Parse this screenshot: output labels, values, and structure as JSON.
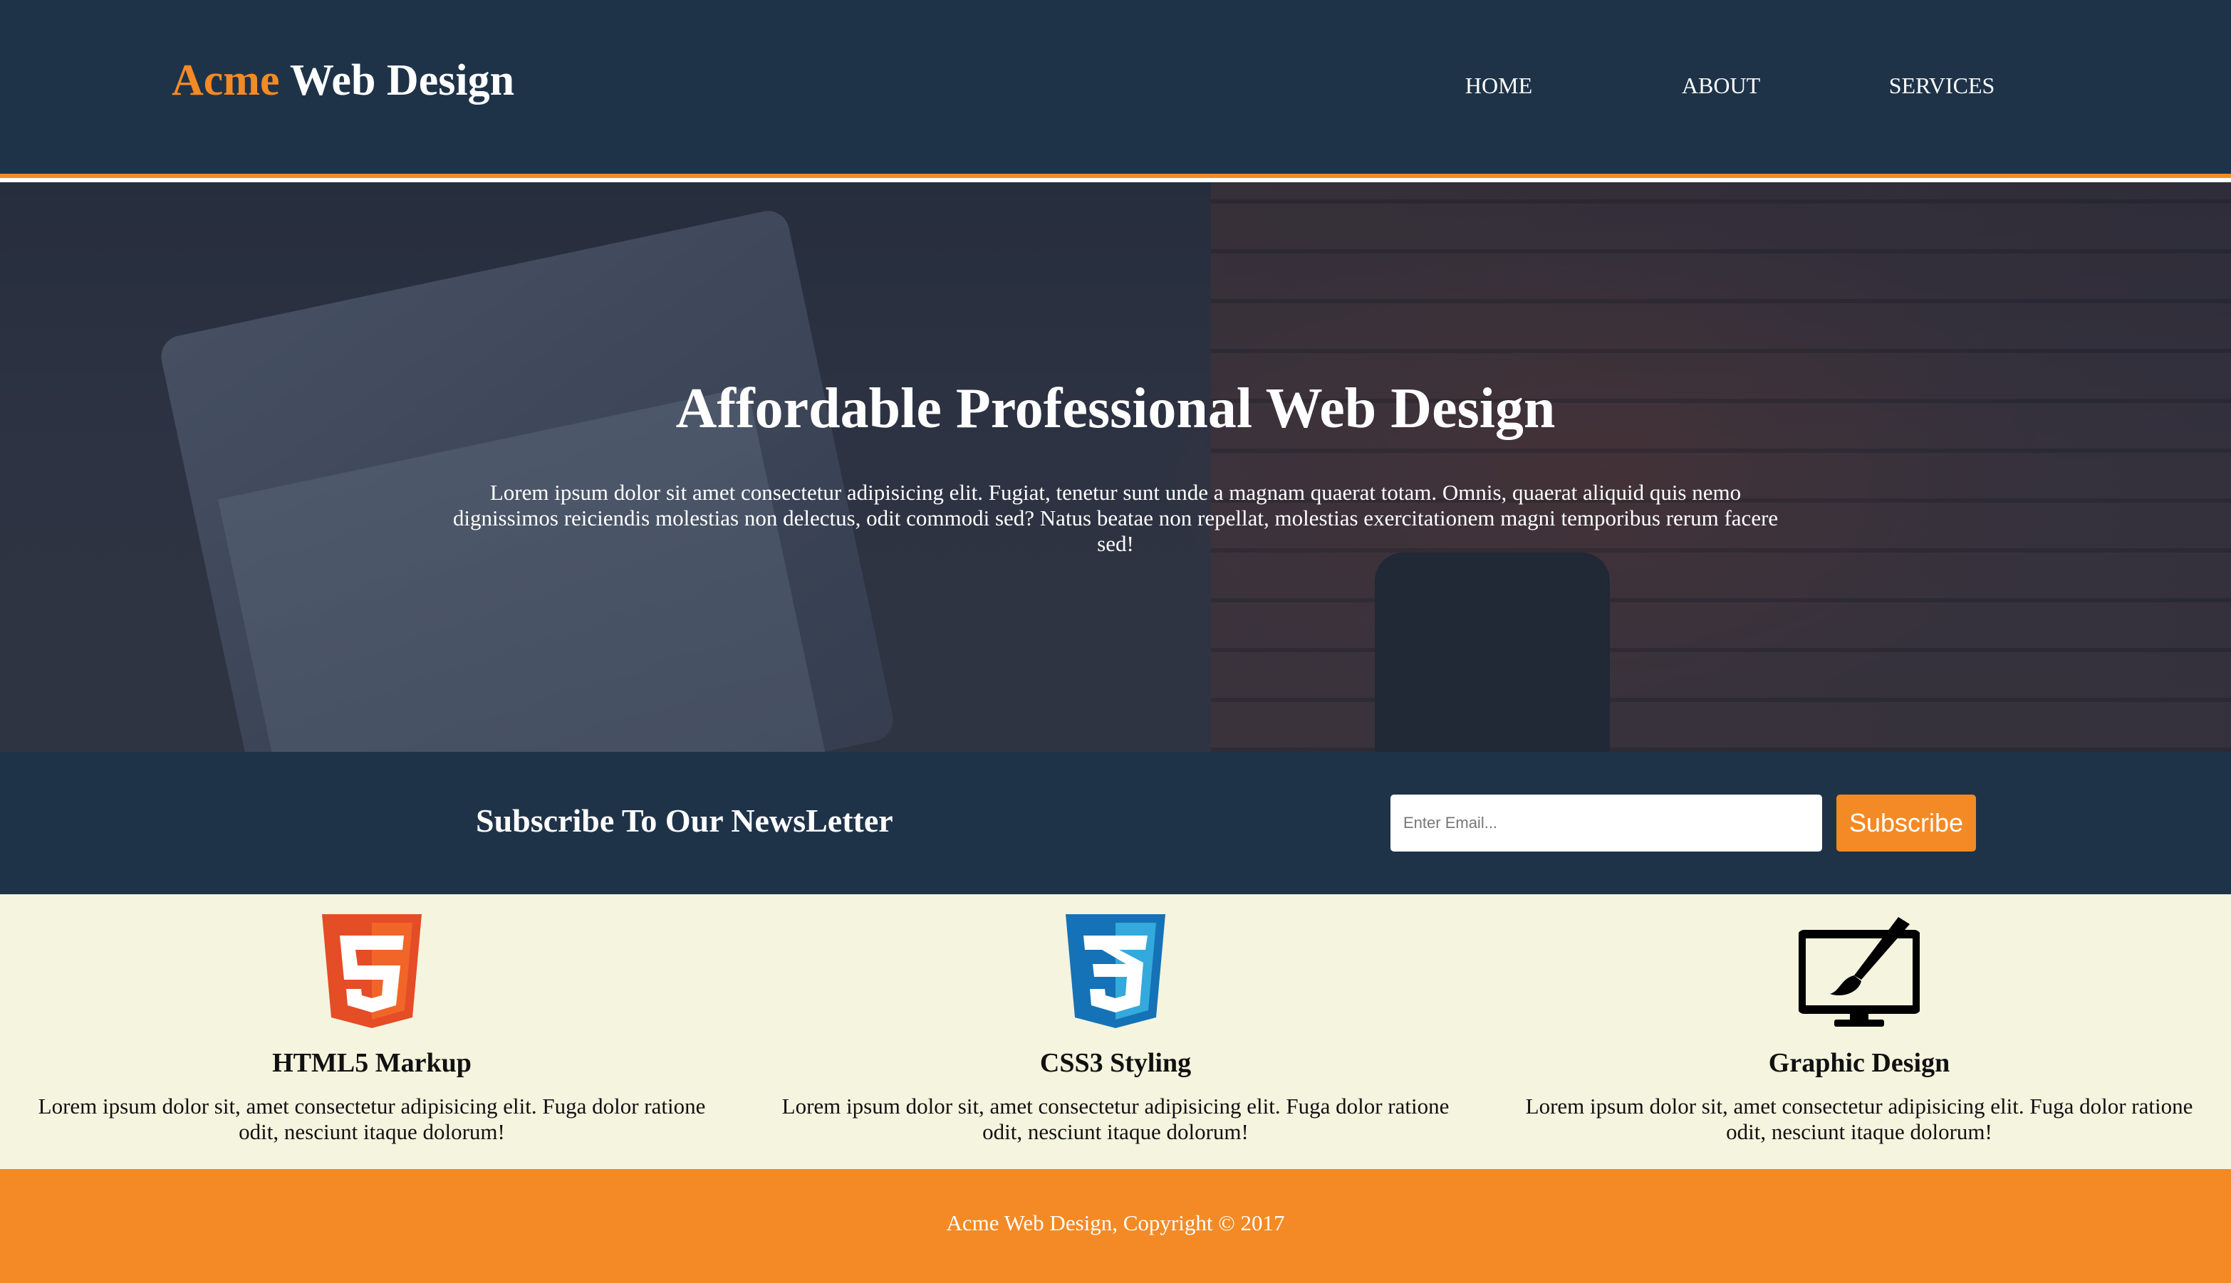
{
  "header": {
    "brand_accent": "Acme",
    "brand_rest": " Web Design",
    "nav": [
      {
        "label": "HOME"
      },
      {
        "label": "ABOUT"
      },
      {
        "label": "SERVICES"
      }
    ]
  },
  "hero": {
    "title": "Affordable Professional Web Design",
    "text": "Lorem ipsum dolor sit amet consectetur adipisicing elit. Fugiat, tenetur sunt unde a magnam quaerat totam. Omnis, quaerat aliquid quis nemo dignissimos reiciendis molestias non delectus, odit commodi sed? Natus beatae non repellat, molestias exercitationem magni temporibus rerum facere sed!"
  },
  "newsletter": {
    "heading": "Subscribe To Our NewsLetter",
    "email_placeholder": "Enter Email...",
    "button_label": "Subscribe"
  },
  "features": [
    {
      "icon": "html5-icon",
      "title": "HTML5 Markup",
      "text": "Lorem ipsum dolor sit, amet consectetur adipisicing elit. Fuga dolor ratione odit, nesciunt itaque dolorum!"
    },
    {
      "icon": "css3-icon",
      "title": "CSS3 Styling",
      "text": "Lorem ipsum dolor sit, amet consectetur adipisicing elit. Fuga dolor ratione odit, nesciunt itaque dolorum!"
    },
    {
      "icon": "graphic-design-icon",
      "title": "Graphic Design",
      "text": "Lorem ipsum dolor sit, amet consectetur adipisicing elit. Fuga dolor ratione odit, nesciunt itaque dolorum!"
    }
  ],
  "footer": {
    "text": "Acme Web Design, Copyright © 2017"
  },
  "colors": {
    "dark_blue": "#1f3348",
    "orange": "#f48a25",
    "cream": "#f4f4df"
  }
}
